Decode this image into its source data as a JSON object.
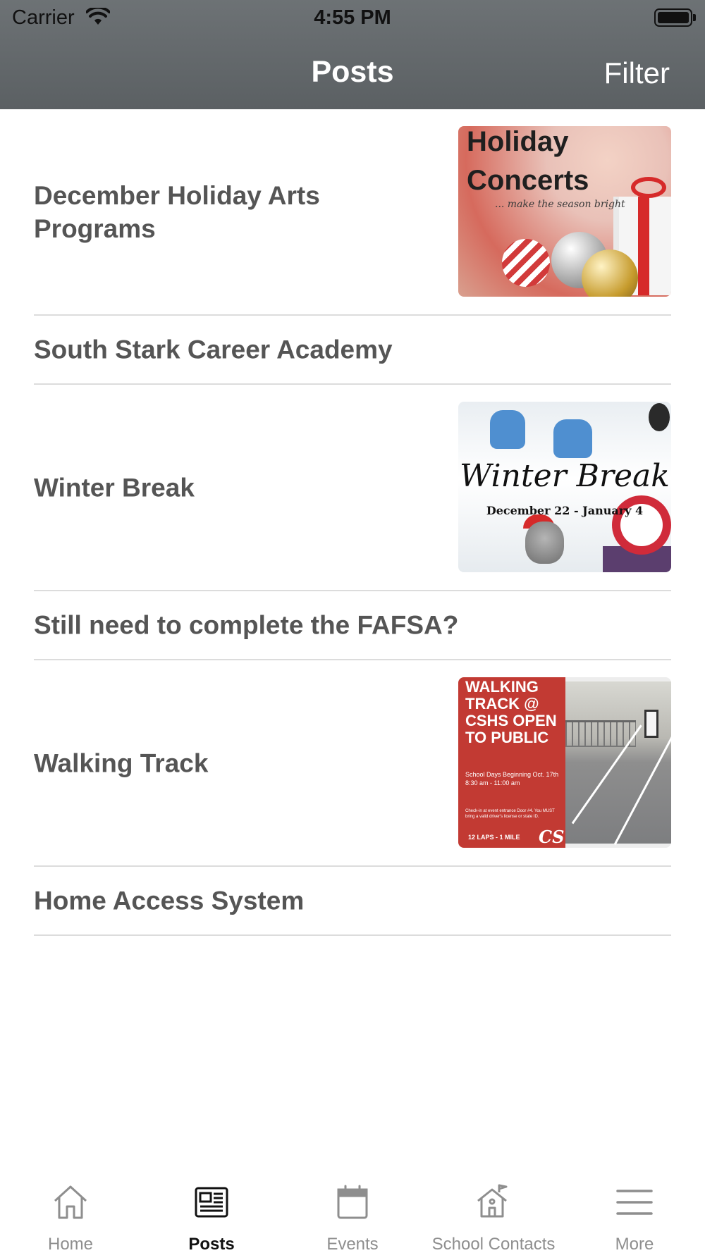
{
  "status_bar": {
    "carrier": "Carrier",
    "time": "4:55 PM"
  },
  "nav": {
    "title": "Posts",
    "filter_label": "Filter"
  },
  "posts": [
    {
      "title": "December Holiday Arts Programs",
      "has_image": true,
      "image": "holiday-concerts",
      "image_text": {
        "line1": "Holiday",
        "line2": "Concerts",
        "tagline": "... make the season bright"
      }
    },
    {
      "title": "South Stark Career Academy",
      "has_image": false
    },
    {
      "title": "Winter Break",
      "has_image": true,
      "image": "winter-break",
      "image_text": {
        "title": "Winter Break",
        "dates": "December 22 - January 4"
      }
    },
    {
      "title": "Still need to complete the FAFSA?",
      "has_image": false
    },
    {
      "title": "Walking Track",
      "has_image": true,
      "image": "walking-track",
      "image_text": {
        "headline": "WALKING TRACK @ CSHS OPEN TO PUBLIC",
        "schedule": "School Days Beginning Oct. 17th 8:30 am - 11:00 am",
        "notice": "Check-in at event entrance Door #4. You MUST bring a valid driver's license or state ID.",
        "laps": "12 LAPS - 1 MILE",
        "logo": "CS"
      }
    },
    {
      "title": "Home Access System",
      "has_image": false
    }
  ],
  "tabs": [
    {
      "label": "Home",
      "icon": "home-icon",
      "active": false
    },
    {
      "label": "Posts",
      "icon": "newspaper-icon",
      "active": true
    },
    {
      "label": "Events",
      "icon": "calendar-icon",
      "active": false
    },
    {
      "label": "School Contacts",
      "icon": "school-icon",
      "active": false
    },
    {
      "label": "More",
      "icon": "menu-icon",
      "active": false
    }
  ],
  "colors": {
    "header": "#616669",
    "title_text": "#555555",
    "divider": "#dcdcdc",
    "tab_inactive": "#8e8e8e",
    "tab_active": "#111111"
  }
}
